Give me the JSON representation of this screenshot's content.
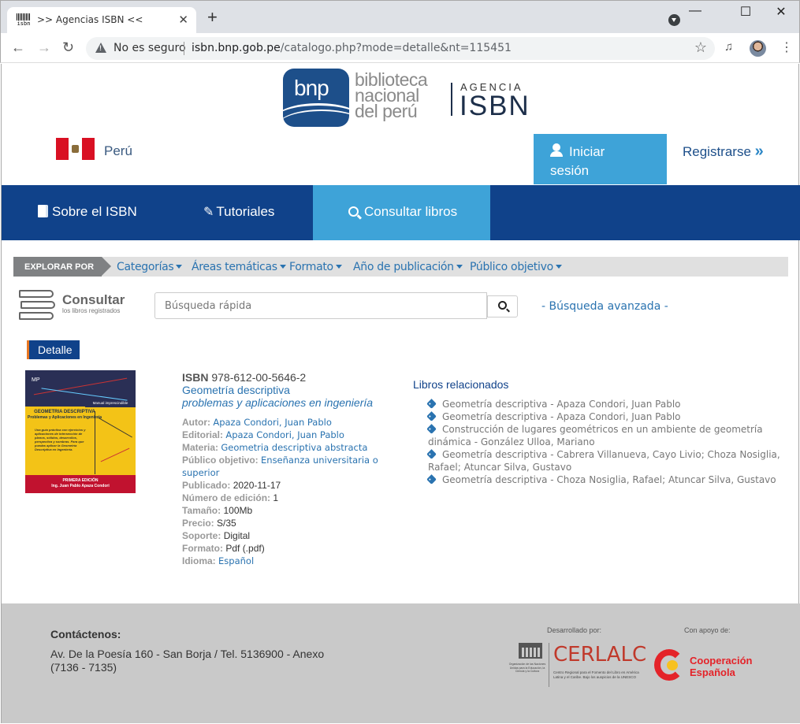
{
  "browser": {
    "tab_title": ">> Agencias ISBN <<",
    "favicon_text": "isbn",
    "security_label": "No es seguro",
    "url_host": "isbn.bnp.gob.pe",
    "url_path": "/catalogo.php?mode=detalle&nt=115451"
  },
  "header": {
    "logo_mark": "bnp",
    "logo_line1": "biblioteca",
    "logo_line2": "nacional",
    "logo_line3": "del perú",
    "agency_small": "AGENCIA",
    "agency_big": "ISBN",
    "country": "Perú",
    "login_line1": "Iniciar",
    "login_line2": "sesión",
    "register": "Registrarse"
  },
  "nav": {
    "items": [
      {
        "label": "Sobre el ISBN",
        "icon": "book-icon"
      },
      {
        "label": "Tutoriales",
        "icon": "pencil-icon"
      },
      {
        "label": "Consultar libros",
        "icon": "search-icon",
        "active": true
      }
    ],
    "active_color": "#3ea3d8",
    "bar_color": "#10428a"
  },
  "explore": {
    "label": "EXPLORAR POR",
    "items": [
      "Categorías",
      "Áreas temáticas",
      "Formato",
      "Año de publicación",
      "Público objetivo"
    ]
  },
  "search": {
    "title": "Consultar",
    "subtitle": "los libros registrados",
    "placeholder": "Búsqueda rápida",
    "advanced": "- Búsqueda avanzada -"
  },
  "detail": {
    "tab_label": "Detalle",
    "cover": {
      "publisher_mark": "MP",
      "badge": "Manual imprescindible",
      "title": "GEOMETRIA DESCRIPTIVA",
      "subtitle": "Problemas y Aplicaciones en Ingeniería",
      "blurb": "Una guía práctica con ejercicios y aplicaciones de intersección de planos, sólidos, desarrollos, perspectiva y sombras. Para que puedas aplicar la Geometría Descriptiva en Ingeniería.",
      "edition": "PRIMERA EDICIÓN",
      "author": "Ing. Juan Pablo Apaza Condori"
    },
    "isbn_label": "ISBN",
    "isbn": "978-612-00-5646-2",
    "title": "Geometría descriptiva",
    "subtitle": "problemas y aplicaciones en ingeniería",
    "fields": {
      "autor_label": "Autor:",
      "autor": "Apaza Condori, Juan Pablo",
      "editorial_label": "Editorial:",
      "editorial": "Apaza Condori, Juan Pablo",
      "materia_label": "Materia:",
      "materia": "Geometria descriptiva abstracta",
      "publico_label": "Público objetivo:",
      "publico": "Enseñanza universitaria o superior",
      "publicado_label": "Publicado:",
      "publicado": "2020-11-17",
      "edicion_label": "Número de edición:",
      "edicion": "1",
      "tamano_label": "Tamaño:",
      "tamano": "100Mb",
      "precio_label": "Precio:",
      "precio": "S/35",
      "soporte_label": "Soporte:",
      "soporte": "Digital",
      "formato_label": "Formato:",
      "formato": "Pdf (.pdf)",
      "idioma_label": "Idioma:",
      "idioma": "Español"
    }
  },
  "related": {
    "title": "Libros relacionados",
    "items": [
      "Geometría descriptiva - Apaza Condori, Juan Pablo",
      "Geometría descriptiva - Apaza Condori, Juan Pablo",
      "Construcción de lugares geométricos en un ambiente de geometría dinámica - González Ulloa, Mariano",
      "Geometría descriptiva - Cabrera Villanueva, Cayo Livio; Choza Nosiglia, Rafael; Atuncar Silva, Gustavo",
      "Geometría descriptiva - Choza Nosiglia, Rafael; Atuncar Silva, Gustavo"
    ]
  },
  "footer": {
    "contact_title": "Contáctenos:",
    "contact_address": "Av. De la Poesía 160 - San Borja / Tel. 5136900 - Anexo (7136 - 7135)",
    "developed_by": "Desarrollado por:",
    "support": "Con apoyo de:",
    "unesco_text": "Organización de las Naciones Unidas para la Educación, la Ciencia y la Cultura",
    "cerlalc": "CERLALC",
    "cerlalc_sub": "Centro Regional para el Fomento del Libro en América Latina y el Caribe. Bajo los auspicios de la UNESCO",
    "coop_line1": "Cooperación",
    "coop_line2": "Española"
  }
}
